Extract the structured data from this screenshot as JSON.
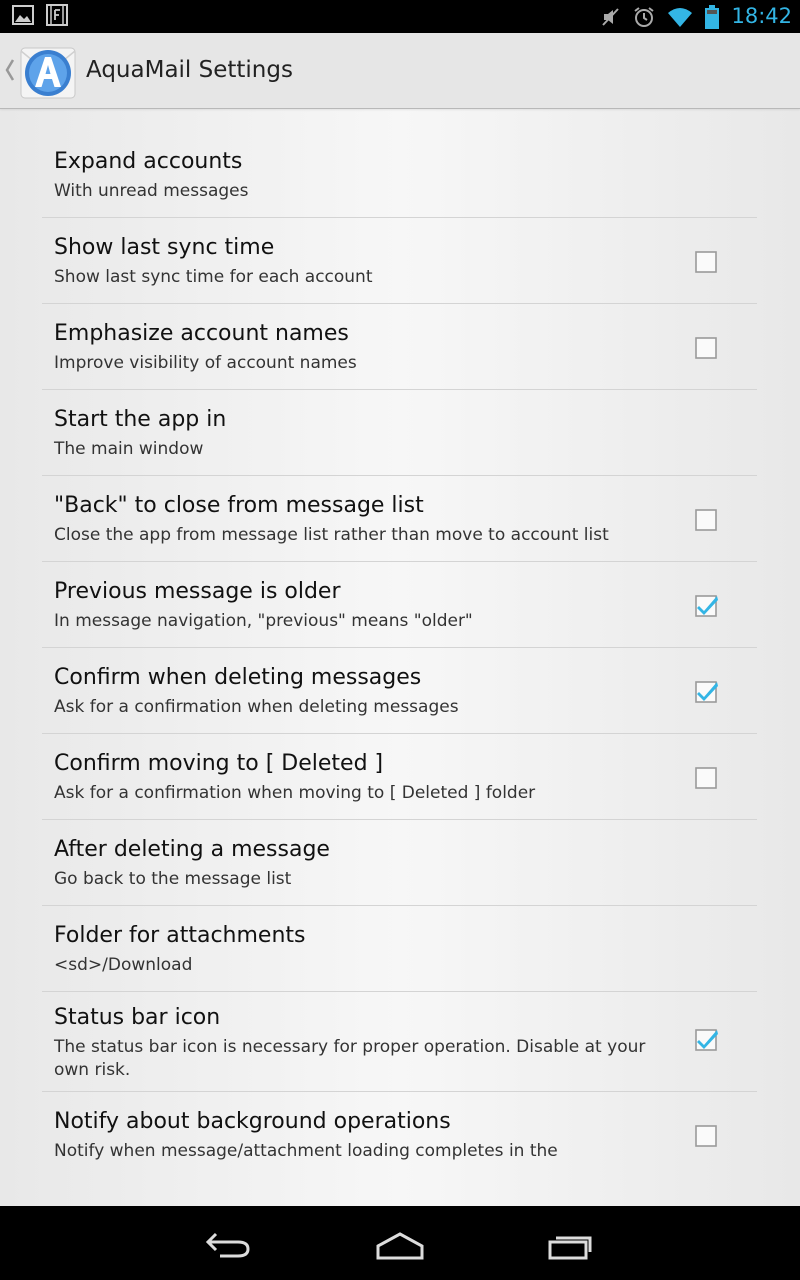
{
  "status_bar": {
    "time": "18:42",
    "icons": [
      "gallery-icon",
      "flipboard-icon",
      "mute-icon",
      "alarm-icon",
      "wifi-icon",
      "battery-icon"
    ],
    "time_color": "#33b5e5"
  },
  "action_bar": {
    "title": "AquaMail Settings",
    "logo_icon": "aquamail-logo-icon"
  },
  "settings": [
    {
      "title": "Expand accounts",
      "summary": "With unread messages",
      "checkbox": null
    },
    {
      "title": "Show last sync time",
      "summary": "Show last sync time for each account",
      "checkbox": false
    },
    {
      "title": "Emphasize account names",
      "summary": "Improve visibility of account names",
      "checkbox": false
    },
    {
      "title": "Start the app in",
      "summary": "The main window",
      "checkbox": null
    },
    {
      "title": "\"Back\" to close from message list",
      "summary": "Close the app from message list rather than move to account list",
      "checkbox": false
    },
    {
      "title": "Previous message is older",
      "summary": "In message navigation, \"previous\" means \"older\"",
      "checkbox": true
    },
    {
      "title": "Confirm when deleting messages",
      "summary": "Ask for a confirmation when deleting messages",
      "checkbox": true
    },
    {
      "title": "Confirm moving to [ Deleted ]",
      "summary": "Ask for a confirmation when moving to [ Deleted ] folder",
      "checkbox": false
    },
    {
      "title": "After deleting a message",
      "summary": "Go back to the message list",
      "checkbox": null
    },
    {
      "title": "Folder for attachments",
      "summary": "<sd>/Download",
      "checkbox": null
    },
    {
      "title": "Status bar icon",
      "summary": "The status bar icon is necessary for proper operation. Disable at your own risk.",
      "checkbox": true
    },
    {
      "title": "Notify about background operations",
      "summary": "Notify when message/attachment loading completes in the",
      "checkbox": false
    }
  ],
  "nav_bar": {
    "buttons": [
      "back-icon",
      "home-icon",
      "recent-apps-icon"
    ]
  },
  "colors": {
    "accent": "#33b5e5",
    "check": "#33b5e5"
  }
}
